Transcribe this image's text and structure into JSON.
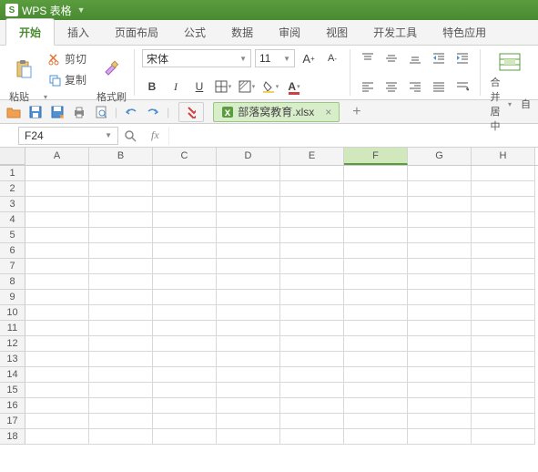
{
  "title": "WPS 表格",
  "menu": {
    "start": "开始",
    "insert": "插入",
    "layout": "页面布局",
    "formula": "公式",
    "data": "数据",
    "review": "审阅",
    "view": "视图",
    "dev": "开发工具",
    "special": "特色应用"
  },
  "ribbon": {
    "paste": "粘贴",
    "cut": "剪切",
    "copy": "复制",
    "format_painter": "格式刷",
    "font": "宋体",
    "size": "11",
    "merge": "合并居中",
    "auto": "自"
  },
  "doc": {
    "filename": "部落窝教育.xlsx"
  },
  "cellref": "F24",
  "fx": "fx",
  "cols": [
    "A",
    "B",
    "C",
    "D",
    "E",
    "F",
    "G",
    "H"
  ],
  "rows": [
    "1",
    "2",
    "3",
    "4",
    "5",
    "6",
    "7",
    "8",
    "9",
    "10",
    "11",
    "12",
    "13",
    "14",
    "15",
    "16",
    "17",
    "18"
  ],
  "selcol": "F"
}
